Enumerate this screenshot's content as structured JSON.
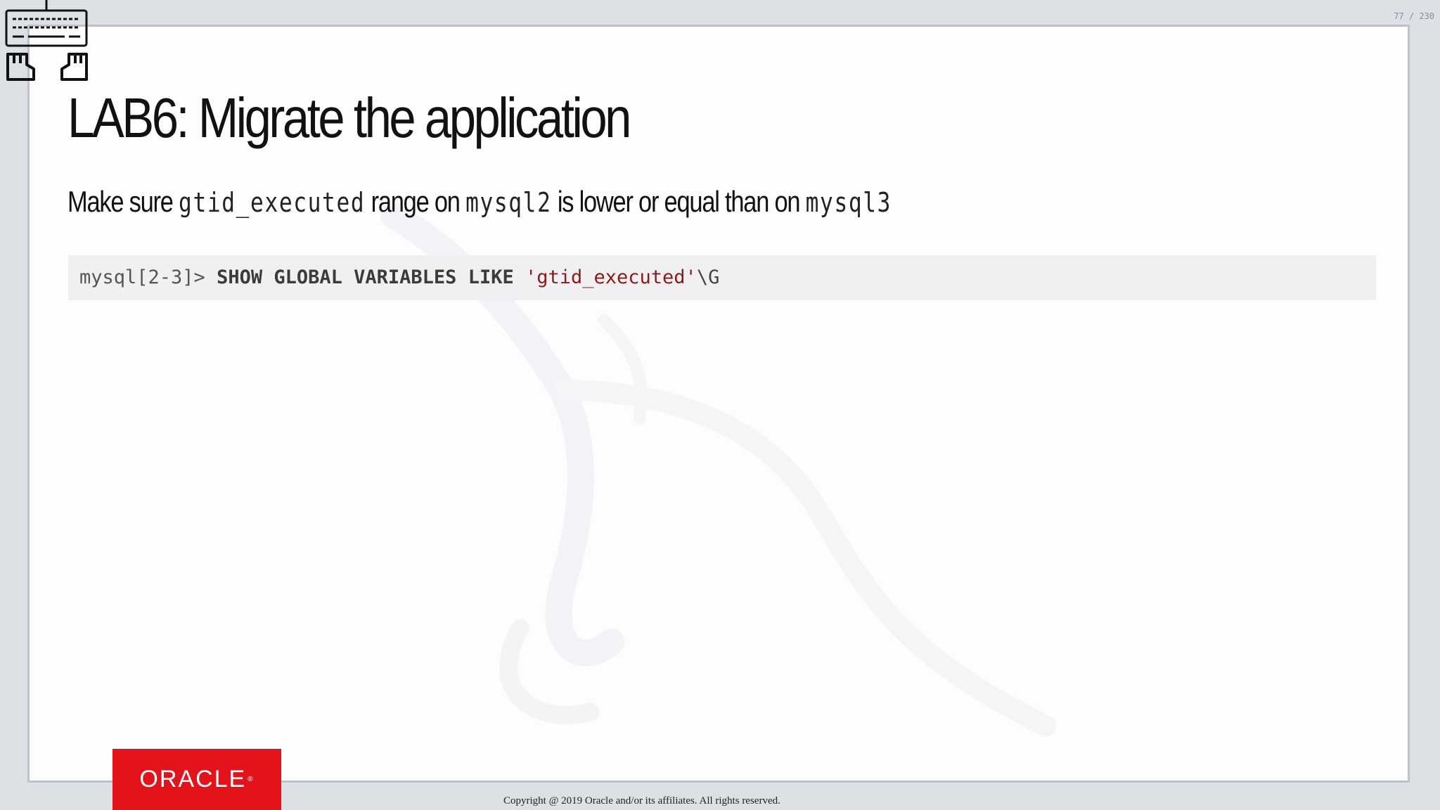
{
  "slide_counter": "77 / 230",
  "title": "LAB6: Migrate the application",
  "subtitle": {
    "part1": "Make sure ",
    "code1": "gtid_executed",
    "part2": " range on ",
    "code2": "mysql2",
    "part3": " is lower or equal than on ",
    "code3": "mysql3"
  },
  "code": {
    "prompt": "mysql[2-3]> ",
    "keywords": "SHOW GLOBAL VARIABLES LIKE",
    "string": "'gtid_executed'",
    "escape": "\\G"
  },
  "logo": "ORACLE",
  "logo_reg": "®",
  "copyright": "Copyright @ 2019 Oracle and/or its affiliates. All rights reserved.",
  "icons": {
    "keyboard": "keyboard-icon",
    "left_hand": "hand-icon",
    "right_hand": "hand-icon",
    "watermark": "dolphin-watermark"
  },
  "colors": {
    "background": "#dde1e6",
    "slide": "#fdfdfe",
    "code_bg": "#f0eff1",
    "code_string": "#8b1a1a",
    "oracle_red": "#e3121b"
  }
}
